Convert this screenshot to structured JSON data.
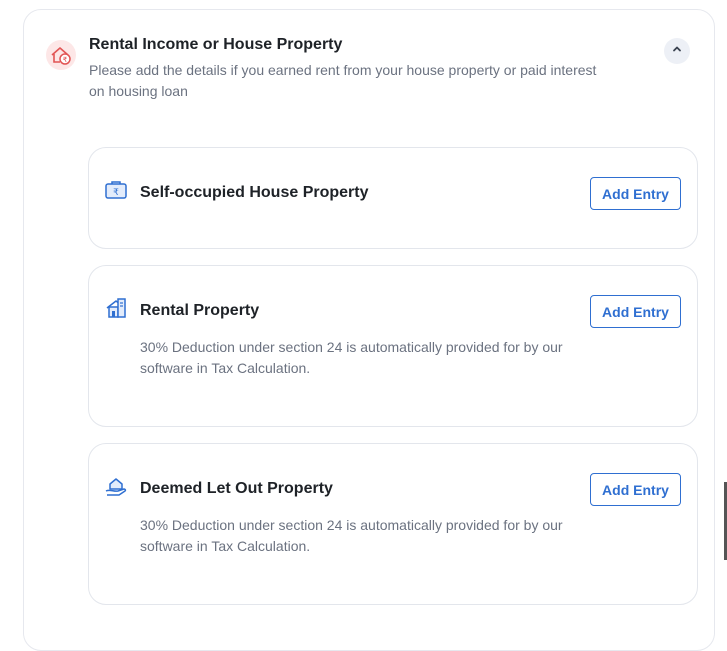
{
  "section": {
    "title": "Rental Income or House Property",
    "subtitle": "Please add the details if you earned rent from your house property or paid interest on housing loan",
    "icon": "house-rupee-icon",
    "collapse_icon": "chevron-up-icon"
  },
  "cards": [
    {
      "title": "Self-occupied House Property",
      "icon": "rupee-briefcase-icon",
      "button": "Add Entry"
    },
    {
      "title": "Rental Property",
      "icon": "building-icon",
      "description": "30% Deduction under section 24 is automatically provided for by our software in Tax Calculation.",
      "button": "Add Entry"
    },
    {
      "title": "Deemed Let Out Property",
      "icon": "hand-house-icon",
      "description": "30% Deduction under section 24 is automatically provided for by our software in Tax Calculation.",
      "button": "Add Entry"
    }
  ],
  "colors": {
    "accent": "#2f6fd1",
    "header_icon": "#e25555",
    "card_icon": "#2f6fd1"
  }
}
